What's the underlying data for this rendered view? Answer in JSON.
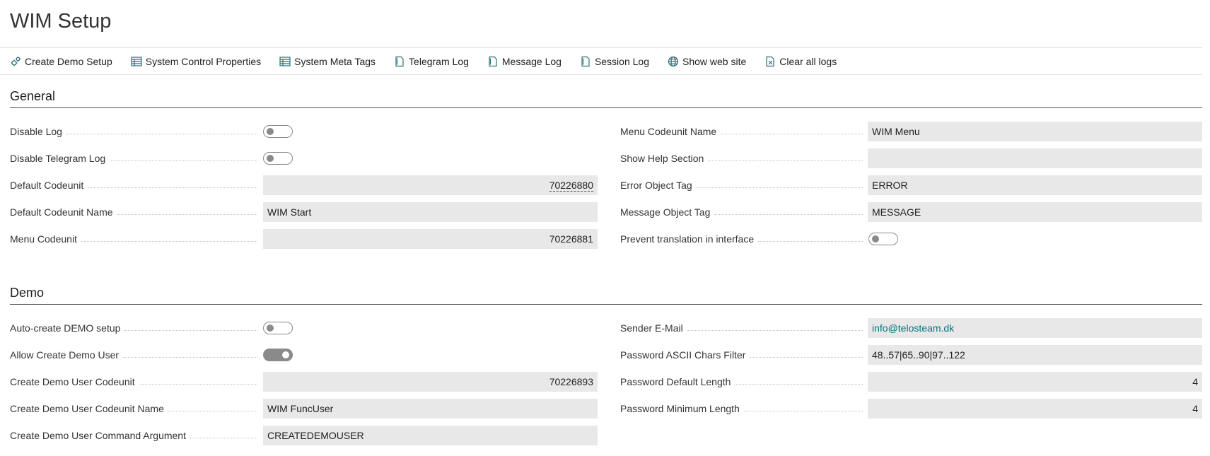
{
  "page": {
    "title": "WIM Setup"
  },
  "actions": [
    {
      "label": "Create Demo Setup",
      "icon": "gears-icon"
    },
    {
      "label": "System Control Properties",
      "icon": "table-icon"
    },
    {
      "label": "System Meta Tags",
      "icon": "table-icon"
    },
    {
      "label": "Telegram Log",
      "icon": "document-icon"
    },
    {
      "label": "Message Log",
      "icon": "document-icon"
    },
    {
      "label": "Session Log",
      "icon": "document-icon"
    },
    {
      "label": "Show web site",
      "icon": "globe-icon"
    },
    {
      "label": "Clear all logs",
      "icon": "clear-document-icon"
    }
  ],
  "general": {
    "title": "General",
    "left": [
      {
        "label": "Disable Log",
        "type": "toggle",
        "on": false
      },
      {
        "label": "Disable Telegram Log",
        "type": "toggle",
        "on": false
      },
      {
        "label": "Default Codeunit",
        "type": "number",
        "value": "70226880",
        "drilldown": true
      },
      {
        "label": "Default Codeunit Name",
        "type": "text",
        "value": "WIM Start"
      },
      {
        "label": "Menu Codeunit",
        "type": "number",
        "value": "70226881"
      }
    ],
    "right": [
      {
        "label": "Menu Codeunit Name",
        "type": "text",
        "value": "WIM Menu"
      },
      {
        "label": "Show Help Section",
        "type": "text",
        "value": ""
      },
      {
        "label": "Error Object Tag",
        "type": "text",
        "value": "ERROR"
      },
      {
        "label": "Message Object Tag",
        "type": "text",
        "value": "MESSAGE"
      },
      {
        "label": "Prevent translation in interface",
        "type": "toggle",
        "on": false
      }
    ]
  },
  "demo": {
    "title": "Demo",
    "left": [
      {
        "label": "Auto-create DEMO setup",
        "type": "toggle",
        "on": false
      },
      {
        "label": "Allow Create Demo User",
        "type": "toggle",
        "on": true
      },
      {
        "label": "Create Demo User Codeunit",
        "type": "number",
        "value": "70226893"
      },
      {
        "label": "Create Demo User Codeunit Name",
        "type": "text",
        "value": "WIM FuncUser"
      },
      {
        "label": "Create Demo User Command Argument",
        "type": "text",
        "value": "CREATEDEMOUSER"
      }
    ],
    "right": [
      {
        "label": "Sender E-Mail",
        "type": "link",
        "value": "info@telosteam.dk"
      },
      {
        "label": "Password ASCII Chars Filter",
        "type": "text",
        "value": "48..57|65..90|97..122"
      },
      {
        "label": "Password Default Length",
        "type": "number",
        "value": "4"
      },
      {
        "label": "Password Minimum Length",
        "type": "number",
        "value": "4"
      }
    ]
  },
  "colors": {
    "accent": "#00757a",
    "field_bg": "#e8e8e9",
    "toggle": "#8a8a8a"
  }
}
